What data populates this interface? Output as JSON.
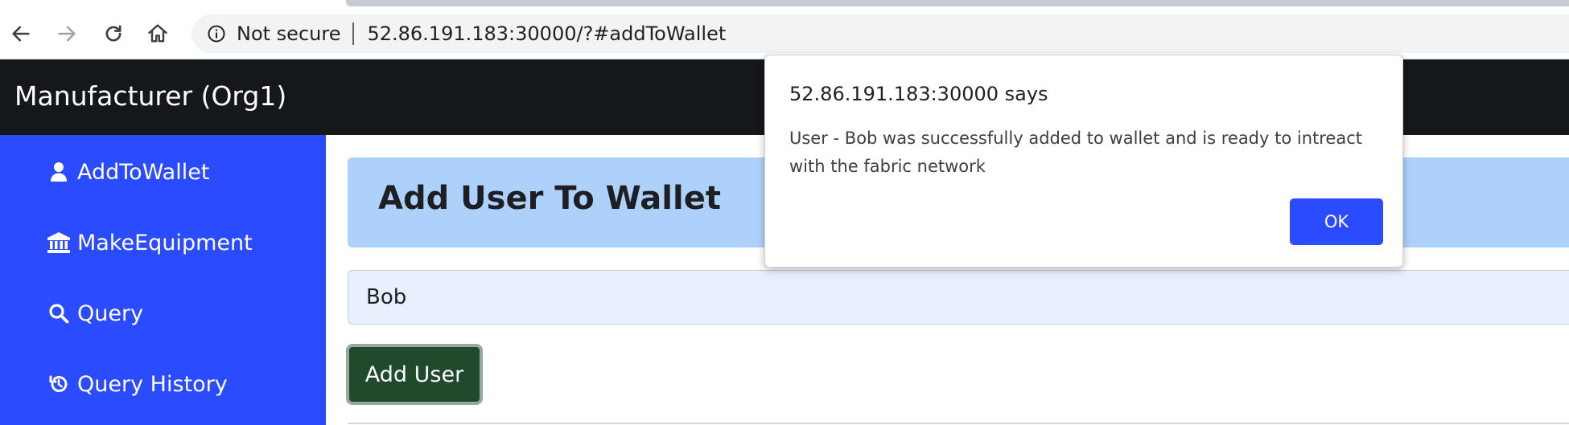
{
  "browser": {
    "security_label": "Not secure",
    "url": "52.86.191.183:30000/?#addToWallet"
  },
  "navbar": {
    "brand": "Manufacturer (Org1)"
  },
  "sidebar": {
    "items": [
      {
        "label": "AddToWallet",
        "icon": "user-icon"
      },
      {
        "label": "MakeEquipment",
        "icon": "bank-icon"
      },
      {
        "label": "Query",
        "icon": "search-icon"
      },
      {
        "label": "Query History",
        "icon": "history-icon"
      }
    ]
  },
  "main": {
    "title": "Add User To Wallet",
    "name_input_value": "Bob",
    "add_button_label": "Add User"
  },
  "dialog": {
    "origin": "52.86.191.183:30000 says",
    "message": "User - Bob was successfully added to wallet and is ready to intreact with the fabric network",
    "ok_label": "OK"
  },
  "colors": {
    "sidebar_bg": "#2b4bff",
    "navbar_bg": "#15181b",
    "jumbotron_bg": "#aed1fb",
    "add_button_bg": "#1f4a2c",
    "ok_button_bg": "#2b4bff"
  }
}
